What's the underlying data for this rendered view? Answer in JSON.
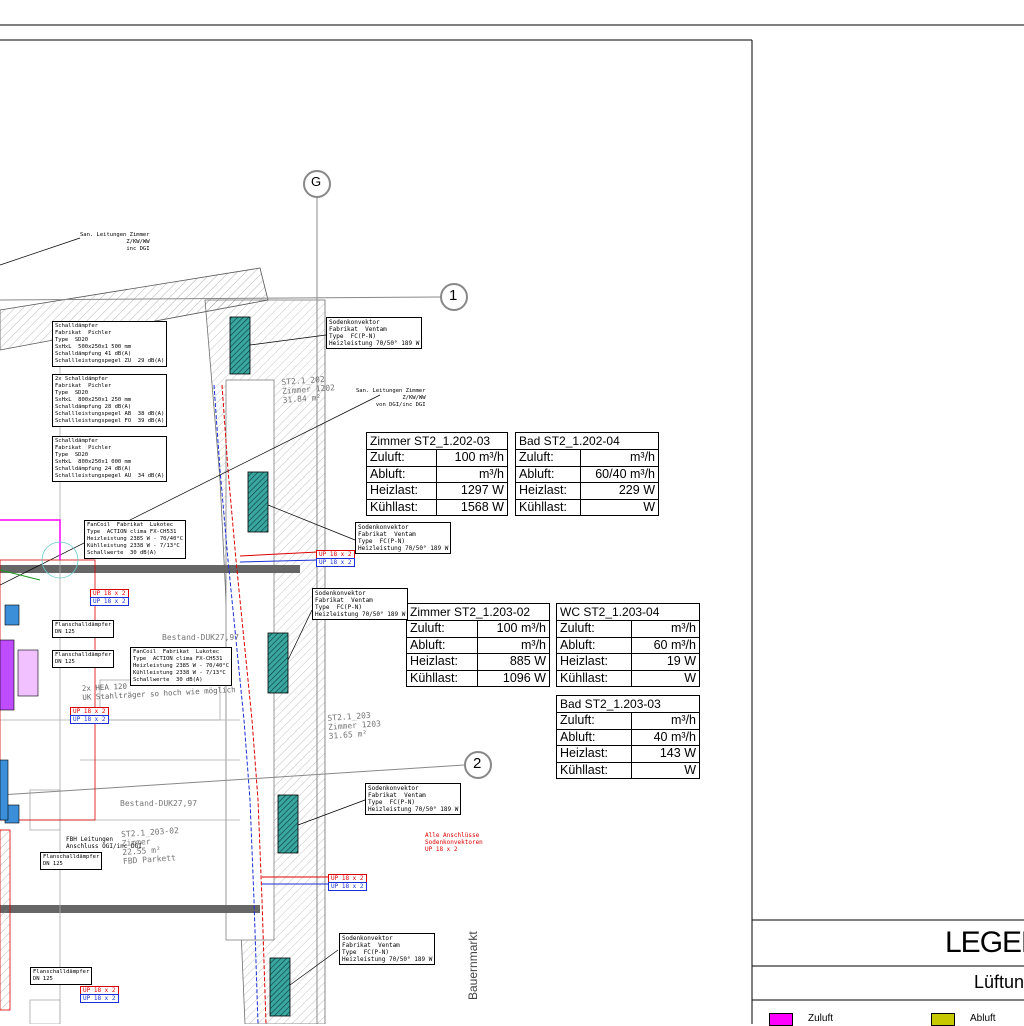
{
  "room_tables": [
    {
      "title": "Zimmer ST2_1.202-03",
      "rows": [
        [
          "Zuluft:",
          "100 m³/h"
        ],
        [
          "Abluft:",
          "m³/h"
        ],
        [
          "Heizlast:",
          "1297 W"
        ],
        [
          "Kühllast:",
          "1568 W"
        ]
      ]
    },
    {
      "title": "Bad ST2_1.202-04",
      "rows": [
        [
          "Zuluft:",
          "m³/h"
        ],
        [
          "Abluft:",
          "60/40 m³/h"
        ],
        [
          "Heizlast:",
          "229 W"
        ],
        [
          "Kühllast:",
          "W"
        ]
      ]
    },
    {
      "title": "Zimmer ST2_1.203-02",
      "rows": [
        [
          "Zuluft:",
          "100 m³/h"
        ],
        [
          "Abluft:",
          "m³/h"
        ],
        [
          "Heizlast:",
          "885 W"
        ],
        [
          "Kühllast:",
          "1096 W"
        ]
      ]
    },
    {
      "title": "WC ST2_1.203-04",
      "rows": [
        [
          "Zuluft:",
          "m³/h"
        ],
        [
          "Abluft:",
          "60 m³/h"
        ],
        [
          "Heizlast:",
          "19 W"
        ],
        [
          "Kühllast:",
          "W"
        ]
      ]
    },
    {
      "title": "Bad ST2_1.203-03",
      "rows": [
        [
          "Zuluft:",
          "m³/h"
        ],
        [
          "Abluft:",
          "40 m³/h"
        ],
        [
          "Heizlast:",
          "143 W"
        ],
        [
          "Kühllast:",
          "W"
        ]
      ]
    }
  ],
  "convector_note": "Sodenkonvektor\nFabrikat  Ventam\nType  FC(P-N)\nHeizleistung 70/50° 189 W",
  "damper_notes": [
    "Schalldämpfer\nFabrikat  Pichler\nType  SD20\nSxHxL  500x250x1 500 mm\nSchalldämpfung 41 dB(A)\nSchallleistungspegel ZU  29 dB(A)",
    "2x Schalldämpfer\nFabrikat  Pichler\nType  SD20\nSxHxL  800x250x1 250 mm\nSchalldämpfung 28 dB(A)\nSchallleistungspegel AB  38 dB(A)\nSchallleistungspegel FO  39 dB(A)",
    "Schalldämpfer\nFabrikat  Pichler\nType  SD20\nSxHxL  800x250x1 000 mm\nSchalldämpfung 24 dB(A)\nSchallleistungspegel AU  34 dB(A)"
  ],
  "fancoil_notes": [
    "FanCoil  Fabrikat  Lukotec\nType  ACTION clima FX-CH531\nHeizleistung 2385 W - 70/40°C\nKühlleistung 2338 W - 7/13°C\nSchallwerte  30 dB(A)",
    "FanCoil  Fabrikat  Lukotec\nType  ACTION clima FX-CH531\nHeizleistung 2385 W - 70/40°C\nKühlleistung 2338 W - 7/13°C\nSchallwerte  30 dB(A)"
  ],
  "san_notes": [
    "San. Leitungen Zimmer\nZ/KW/WW\ninc DGI",
    "San. Leitungen Zimmer\nZ/KW/WW\nvon DGI/inc DGI"
  ],
  "room_labels": [
    "ST2.1_202\nZimmer 1202\n31.84 m²",
    "ST2.1_203\nZimmer 1203\n31.65 m²",
    "ST2.1_203-02\nZimmer\n22.55 m²\nFBD Parkett"
  ],
  "pipe_tags": {
    "up": "UP 18 x 2",
    "down": "UP 18 x 2"
  },
  "misc_labels": {
    "bestand1": "Bestand-DUK27,97",
    "bestand2": "Bestand-DUK27,97",
    "hea": "2x HEA 120\nUK Stahlträger so hoch wie möglich",
    "fbh": "FBH Leitungen\nAnschluss OGI/inc DGI",
    "red_note": "Alle Anschlüsse\nSodenkonvektoren\nUP 18 x 2",
    "street": "Bauernmarkt",
    "flansch": "Flanschalldämpfer\nDN 125"
  },
  "grid_axes": [
    "1",
    "2",
    "G"
  ],
  "legend": {
    "title": "LEGEN",
    "subtitle": "Lüftun",
    "items": [
      {
        "label": "Zuluft",
        "color": "#ff00ff"
      },
      {
        "label": "Abluft",
        "color": "#c8c800"
      }
    ]
  },
  "colors": {
    "supply": "#ff00ff",
    "exhaust": "#c8c800",
    "pipe_red": "#dd0000",
    "pipe_blue": "#1a2fd6",
    "convector": "#3aa6a0"
  }
}
